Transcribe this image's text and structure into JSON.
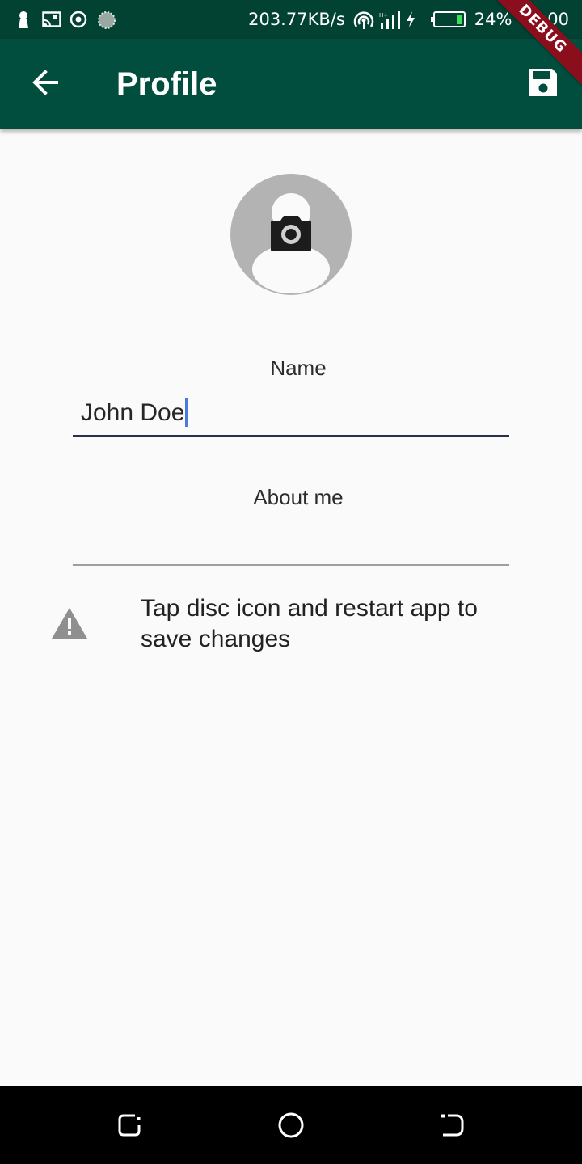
{
  "status_bar": {
    "speed": "203.77KB/s",
    "battery": "24%",
    "time": "00:00",
    "icons": [
      "keyhole-icon",
      "screencast-icon",
      "target-icon",
      "loader-icon",
      "hotspot-icon",
      "signal-icon",
      "charging-icon",
      "battery-icon"
    ]
  },
  "app_bar": {
    "title": "Profile",
    "back_icon": "arrow-back-icon",
    "save_icon": "floppy-disk-icon",
    "debug_label": "DEBUG"
  },
  "profile": {
    "avatar_icon": "person-placeholder-icon",
    "camera_icon": "camera-icon",
    "name_label": "Name",
    "name_value": "John Doe",
    "about_label": "About me",
    "about_value": ""
  },
  "notice": {
    "icon": "warning-icon",
    "text": "Tap disc icon and restart app to save changes"
  },
  "nav_bar": {
    "icons": [
      "recents-icon",
      "home-icon",
      "back-icon"
    ]
  },
  "colors": {
    "status_bar": "#024232",
    "app_bar": "#014e3f",
    "background": "#fafafa",
    "debug_ribbon": "#8a0e1c",
    "caret": "#4a7ae0"
  }
}
